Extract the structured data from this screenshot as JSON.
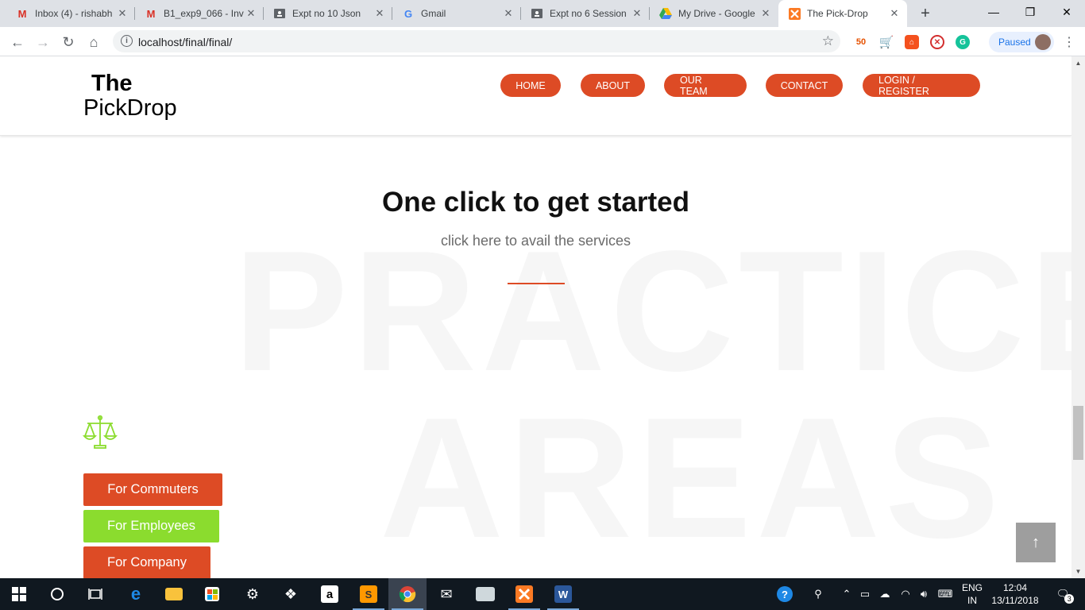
{
  "browser": {
    "tabs": [
      {
        "title": "Inbox (4) - rishabh",
        "icon": "gmail-icon",
        "active": false
      },
      {
        "title": "B1_exp9_066 - Inv",
        "icon": "gmail-icon",
        "active": false
      },
      {
        "title": "Expt no 10 Json",
        "icon": "classroom-icon",
        "active": false
      },
      {
        "title": "Gmail",
        "icon": "google-icon",
        "active": false
      },
      {
        "title": "Expt no 6 Session",
        "icon": "classroom-icon",
        "active": false
      },
      {
        "title": "My Drive - Google",
        "icon": "drive-icon",
        "active": false
      },
      {
        "title": "The Pick-Drop",
        "icon": "xampp-icon",
        "active": true
      }
    ],
    "new_tab": "+",
    "url": "localhost/final/final/",
    "profile_status": "Paused",
    "extensions": [
      "ext-50-icon",
      "ext-cart-icon",
      "ext-lock-icon",
      "ext-block-icon",
      "grammarly-icon"
    ]
  },
  "site": {
    "logo": {
      "line1": "The",
      "line2": "PickDrop"
    },
    "nav": [
      "HOME",
      "ABOUT",
      "OUR TEAM",
      "CONTACT",
      "LOGIN / REGISTER"
    ],
    "heading": "One click to get started",
    "subheading": "click here to avail the services",
    "background_words": [
      "PRACTICE",
      "AREAS"
    ],
    "categories": [
      "For Commuters",
      "For Employees",
      "For Company"
    ],
    "back_to_top": "↑",
    "colors": {
      "accent": "#dd4b25",
      "green": "#8bdc2e",
      "gray_button": "#9e9e9e"
    }
  },
  "taskbar": {
    "apps": [
      "windows-start-icon",
      "cortana-search-icon",
      "task-view-icon",
      "edge-icon",
      "file-explorer-icon",
      "store-icon",
      "settings-icon",
      "dropbox-icon",
      "amazon-icon",
      "sublime-text-icon",
      "chrome-icon",
      "mail-icon",
      "photos-icon",
      "xampp-icon",
      "word-icon"
    ],
    "lang_line1": "ENG",
    "lang_line2": "IN",
    "time": "12:04",
    "date": "13/11/2018",
    "notifications": "3"
  }
}
